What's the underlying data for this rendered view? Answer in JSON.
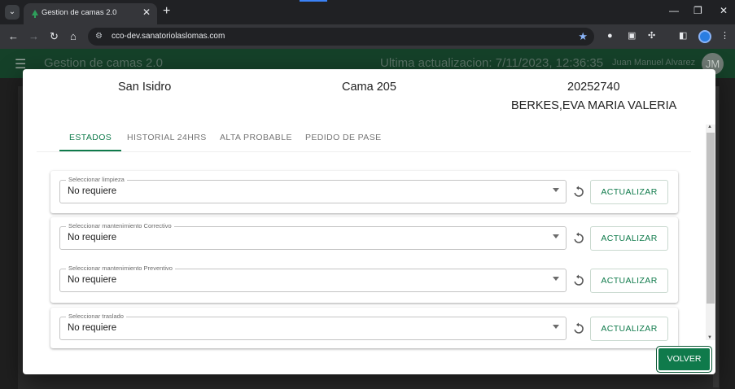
{
  "browser": {
    "tab_title": "Gestion de camas 2.0",
    "url": "cco-dev.sanatoriolaslomas.com"
  },
  "app": {
    "title": "Gestion de camas 2.0",
    "last_update": "Ultima actualizacion: 7/11/2023, 12:36:35",
    "user_name": "Juan Manuel Alvarez",
    "user_initials": "JM"
  },
  "modal": {
    "sector": "San Isidro",
    "bed": "Cama 205",
    "patient_id": "20252740",
    "patient_name": "BERKES,EVA MARIA VALERIA",
    "tabs": [
      {
        "label": "ESTADOS"
      },
      {
        "label": "HISTORIAL 24HRS"
      },
      {
        "label": "ALTA PROBABLE"
      },
      {
        "label": "PEDIDO DE PASE"
      }
    ],
    "fields": [
      {
        "legend": "Seleccionar limpieza",
        "value": "No requiere",
        "button": "ACTUALIZAR"
      },
      {
        "legend": "Seleccionar mantenimiento Correctivo",
        "value": "No requiere",
        "button": "ACTUALIZAR"
      },
      {
        "legend": "Seleccionar mantenimiento Preventivo",
        "value": "No requiere",
        "button": "ACTUALIZAR"
      },
      {
        "legend": "Seleccionar traslado",
        "value": "No requiere",
        "button": "ACTUALIZAR"
      }
    ],
    "back_button": "VOLVER"
  },
  "colors": {
    "brand_green": "#0f7a4b",
    "header_green": "#154129"
  }
}
